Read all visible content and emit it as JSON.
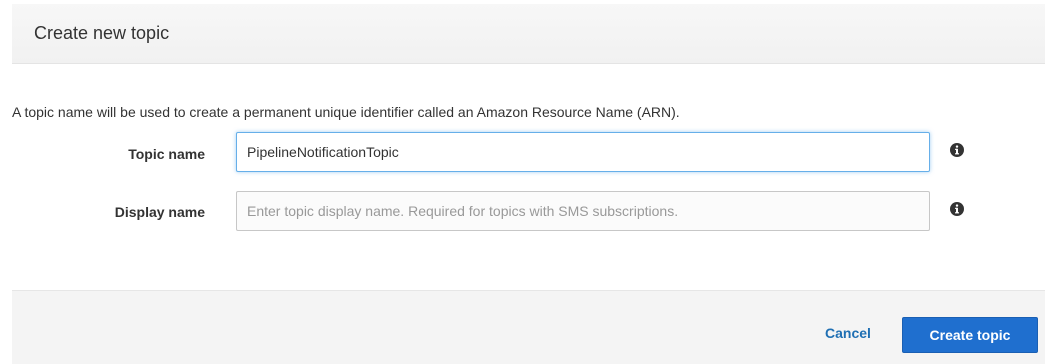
{
  "dialog": {
    "title": "Create new topic",
    "intro": "A topic name will be used to create a permanent unique identifier called an Amazon Resource Name (ARN).",
    "fields": {
      "topic_name": {
        "label": "Topic name",
        "value": "PipelineNotificationTopic",
        "placeholder": "",
        "info_icon": "info-icon"
      },
      "display_name": {
        "label": "Display name",
        "value": "",
        "placeholder": "Enter topic display name. Required for topics with SMS subscriptions.",
        "info_icon": "info-icon"
      }
    },
    "footer": {
      "cancel_label": "Cancel",
      "create_label": "Create topic"
    }
  },
  "colors": {
    "primary_button": "#1f6fcf",
    "link": "#1f6fb3",
    "focus_border": "#66afe9"
  }
}
